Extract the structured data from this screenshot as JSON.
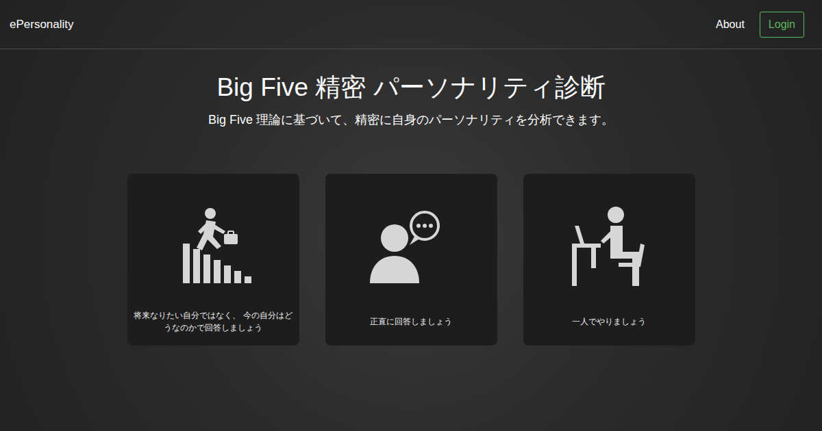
{
  "navbar": {
    "brand": "ePersonality",
    "links": [
      {
        "label": "About"
      }
    ],
    "login_button": "Login"
  },
  "hero": {
    "title": "Big Five 精密 パーソナリティ診断",
    "subtitle": "Big Five 理論に基づいて、精密に自身のパーソナリティを分析できます。"
  },
  "cards": [
    {
      "text": "将来なりたい自分ではなく、 今の自分はどうなのかで回答しましょう"
    },
    {
      "text": "正直に回答しましょう"
    },
    {
      "text": "一人でやりましょう"
    }
  ]
}
